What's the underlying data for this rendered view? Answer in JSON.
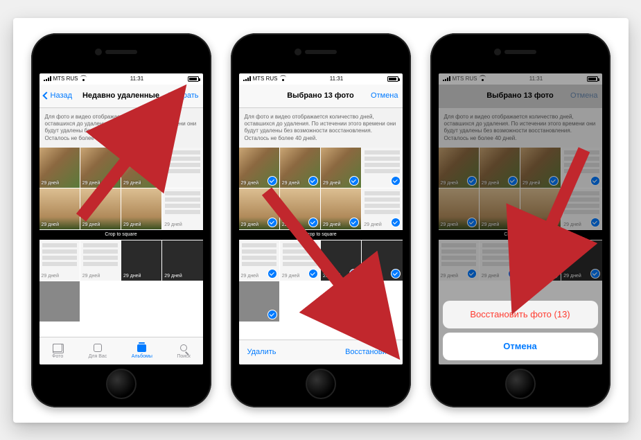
{
  "status": {
    "carrier": "MTS RUS",
    "time": "11:31",
    "wifi": true,
    "battery_pct": 80
  },
  "description_text": "Для фото и видео отображается количество дней, оставшихся до удаления. По истечении этого времени они будут удалены без возможности восстановления. Осталось не более 40 дней.",
  "crop_caption": "Crop to square",
  "thumb_caption": "29 дней",
  "screen1": {
    "back_label": "Назад",
    "title": "Недавно удаленные",
    "select_label": "Выбрать",
    "tabs": {
      "photos": "Фото",
      "foryou": "Для Вас",
      "albums": "Альбомы",
      "search": "Поиск"
    },
    "active_tab": "albums"
  },
  "screen2": {
    "title": "Выбрано 13 фото",
    "cancel_label": "Отмена",
    "delete_label": "Удалить",
    "restore_label": "Восстановить",
    "selected_count": 13
  },
  "screen3": {
    "title": "Выбрано 13 фото",
    "cancel_label": "Отмена",
    "action_restore": "Восстановить фото (13)",
    "action_cancel": "Отмена"
  },
  "grid": {
    "rows": 3,
    "cols": 4
  }
}
